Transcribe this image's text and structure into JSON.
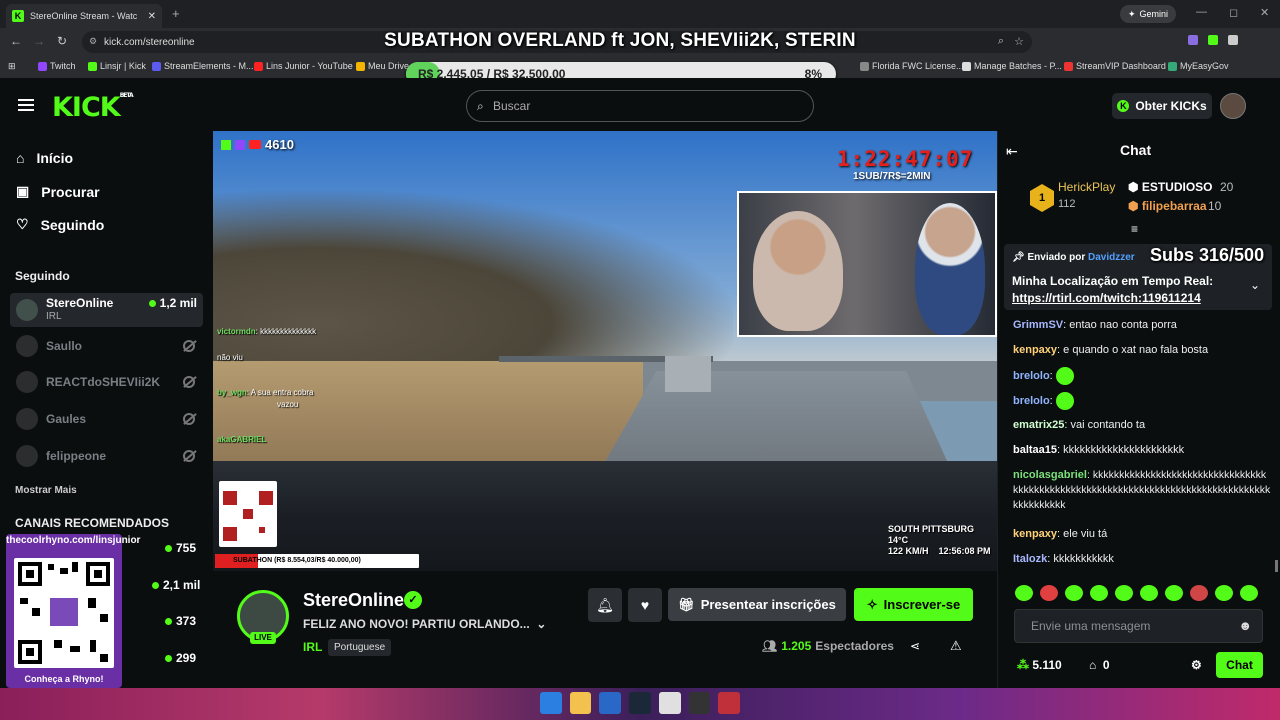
{
  "browser": {
    "tab_title": "StereOnline Stream - Watc",
    "url": "kick.com/stereonline",
    "gemini_label": "Gemini",
    "bookmarks": [
      "Twitch",
      "Linsjr | Kick",
      "StreamElements - M...",
      "Lins Junior - YouTube",
      "Meu Drive",
      "Florida FWC License...",
      "Manage Batches - P...",
      "StreamVIP Dashboard",
      "MyEasyGov"
    ]
  },
  "stream_overlay": {
    "title": "SUBATHON OVERLAND ft JON, SHEVIii2K, STERIN",
    "goal_text": "R$ 2.445,05 / R$ 32.500,00",
    "goal_percent": "8%",
    "goal_fraction": 0.08,
    "viewer_badge": "4610",
    "timer": "1:22:47:07",
    "rate": "1SUB/7R$=2MIN",
    "subathon_bar": "SUBATHON (R$ 8.554,03/R$ 40.000,00)",
    "subathon_fraction": 0.21,
    "location_name": "SOUTH PITTSBURG",
    "location_temp": "14°C",
    "location_speed": "122 KM/H",
    "location_time": "12:56:08 PM",
    "subs_goal": "Subs 316/500",
    "mini_chat": [
      {
        "user": "victormdn",
        "text": "kkkkkkkkkkkkkk"
      },
      {
        "user": "by_wgn",
        "text": "A sua entra cobra"
      },
      {
        "user": "",
        "text": "vazou"
      },
      {
        "user": "",
        "text": "não viu"
      },
      {
        "user": "akaGABRIEL",
        "text": ""
      }
    ]
  },
  "header": {
    "logo": "KICK",
    "logo_beta": "BETA",
    "search_placeholder": "Buscar",
    "get_kicks": "Obter KICKs"
  },
  "sidebar": {
    "nav": [
      "Início",
      "Procurar",
      "Seguindo"
    ],
    "following_header": "Seguindo",
    "following": [
      {
        "name": "StereOnline",
        "sub": "IRL",
        "viewers": "1,2 mil",
        "live": true
      },
      {
        "name": "Saullo",
        "live": false
      },
      {
        "name": "REACTdoSHEVIii2K",
        "live": false
      },
      {
        "name": "Gaules",
        "live": false
      },
      {
        "name": "felippeone",
        "live": false
      }
    ],
    "show_more": "Mostrar Mais",
    "recommended_header": "CANAIS RECOMENDADOS",
    "recommended_viewers": [
      "755",
      "2,1 mil",
      "373",
      "299"
    ]
  },
  "qr_widget": {
    "top": "thecoolrhyno.com/linsjunior",
    "bottom": "Conheça a Rhyno!"
  },
  "stream_info": {
    "channel": "StereOnline",
    "live_label": "LIVE",
    "title": "FELIZ ANO NOVO! PARTIU ORLANDO...",
    "category": "IRL",
    "language": "Portuguese",
    "gift_button": "Presentear inscrições",
    "subscribe_button": "Inscrever-se",
    "viewers": "1.205",
    "viewers_label": "Espectadores"
  },
  "chat": {
    "title": "Chat",
    "leaderboard": [
      {
        "name": "HerickPlay",
        "value": "112"
      },
      {
        "name": "ESTUDIOSO",
        "value": "20"
      },
      {
        "name": "filipebarraa",
        "value": "10"
      }
    ],
    "pinned_by_label": "Enviado por",
    "pinned_by_user": "Davidzzer",
    "pinned_text": "Minha Localização em Tempo Real:",
    "pinned_link": "https://rtirl.com/twitch:119611214",
    "messages": [
      {
        "user": "GrimmSV",
        "text": "entao nao conta porra",
        "color": "#a8b8ff"
      },
      {
        "user": "kenpaxy",
        "text": "e quando o xat nao fala bosta",
        "color": "#ffd27a"
      },
      {
        "user": "brelolo",
        "text": "",
        "color": "#8fb4ff",
        "emote": true
      },
      {
        "user": "brelolo",
        "text": "",
        "color": "#8fb4ff",
        "emote": true
      },
      {
        "user": "ematrix25",
        "text": "vai contando ta",
        "color": "#d0ffd0"
      },
      {
        "user": "baltaa15",
        "text": "kkkkkkkkkkkkkkkkkkkkkk",
        "color": "#ffffff"
      },
      {
        "user": "nicolasgabriel",
        "text": "kkkkkkkkkkkkkkkkkkkkkkkkkkkkkkkkkkkkkkkkkkkkkkkkkkkkkkkkkkkkkkkkkkkkkkkkkkkkkkkkkkkkkkkkkkkk",
        "color": "#7be07b"
      },
      {
        "user": "kenpaxy",
        "text": "ele viu tá",
        "color": "#ffd27a"
      },
      {
        "user": "Italozk",
        "text": "kkkkkkkkkkk",
        "color": "#a8b8ff"
      }
    ],
    "input_placeholder": "Envie uma mensagem",
    "points": "5.110",
    "store_count": "0",
    "send_button": "Chat"
  },
  "colors": {
    "accent": "#53fc18",
    "bg": "#0b0e0f",
    "panel": "#24272c",
    "timer": "#e4201c"
  }
}
